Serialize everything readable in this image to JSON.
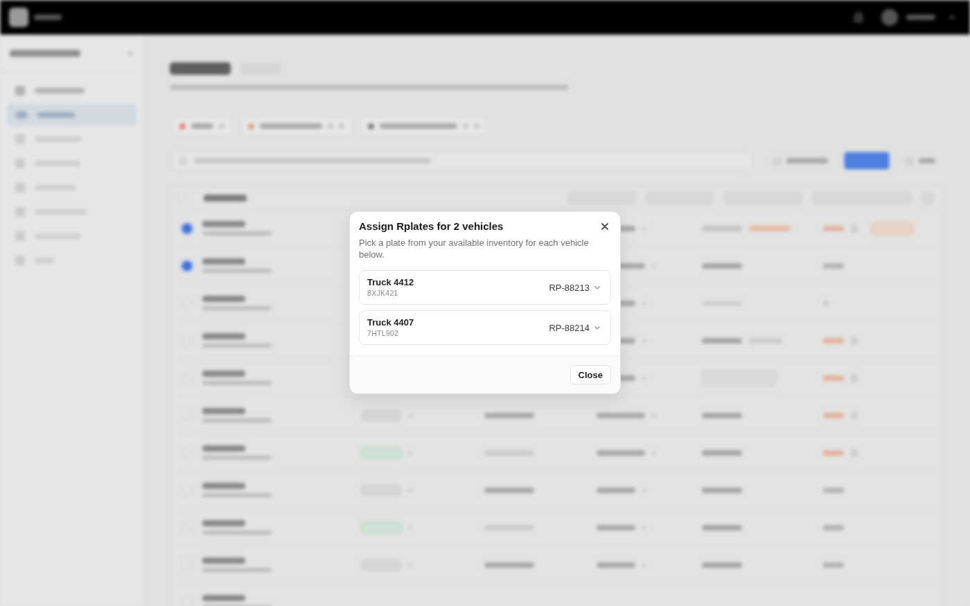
{
  "dialog": {
    "title": "Assign Rplates for 2 vehicles",
    "description": "Pick a plate from your available inventory for each vehicle below.",
    "vehicles": [
      {
        "name": "Truck 4412",
        "plate": "8XJK421",
        "rplate": "RP-88213"
      },
      {
        "name": "Truck 4407",
        "plate": "7HTL902",
        "rplate": "RP-88214"
      }
    ],
    "close_button": "Close"
  }
}
